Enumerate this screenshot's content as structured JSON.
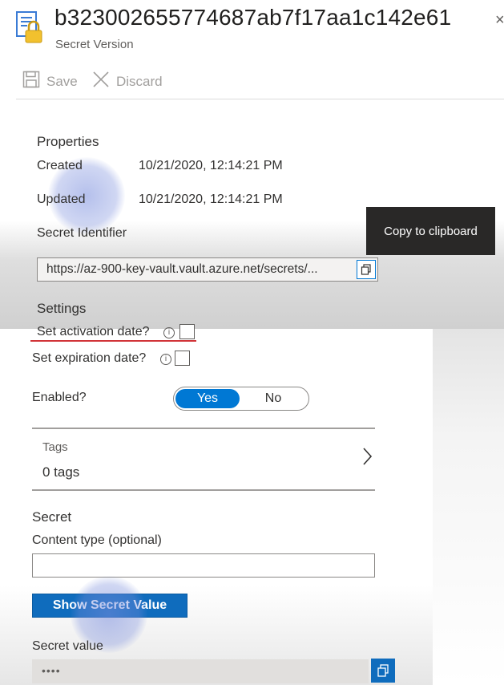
{
  "header": {
    "title": "b323002655774687ab7f17aa1c142e61",
    "subtitle": "Secret Version",
    "close_glyph": "×",
    "icon": "key-vault-secret-icon"
  },
  "toolbar": {
    "save_label": "Save",
    "discard_label": "Discard"
  },
  "properties": {
    "title": "Properties",
    "created_label": "Created",
    "created_value": "10/21/2020, 12:14:21 PM",
    "updated_label": "Updated",
    "updated_value": "10/21/2020, 12:14:21 PM",
    "secret_identifier_label": "Secret Identifier",
    "secret_identifier_value": "https://az-900-key-vault.vault.azure.net/secrets/..."
  },
  "tooltip": {
    "text": "Copy to clipboard"
  },
  "settings": {
    "title": "Settings",
    "activation_label": "Set activation date?",
    "activation_checked": false,
    "expiration_label": "Set expiration date?",
    "expiration_checked": false,
    "info_glyph": "i",
    "enabled_label": "Enabled?",
    "enabled_yes": "Yes",
    "enabled_no": "No",
    "enabled_selected": "Yes"
  },
  "tags": {
    "title": "Tags",
    "count_text": "0 tags"
  },
  "secret": {
    "title": "Secret",
    "content_type_label": "Content type (optional)",
    "content_type_value": "",
    "show_button_label": "Show Secret Value",
    "secret_value_label": "Secret value",
    "secret_value_masked": "••••"
  },
  "colors": {
    "accent": "#0078d4",
    "button_blue": "#0f6cbd",
    "error_underline": "#d13438",
    "tooltip_bg": "#292827"
  }
}
